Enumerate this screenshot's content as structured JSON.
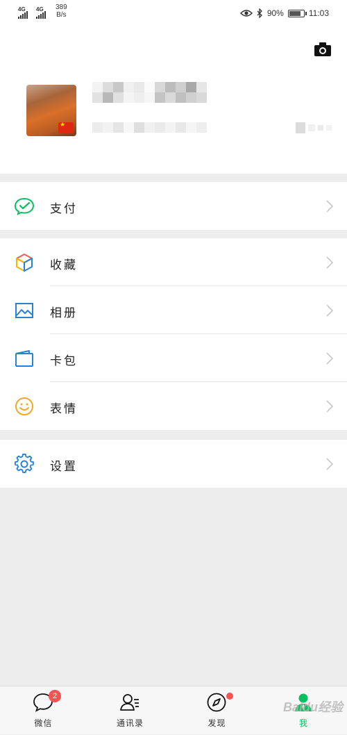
{
  "status_bar": {
    "sim1": "4G",
    "sim2": "4G",
    "net_speed_value": "389",
    "net_speed_unit": "B/s",
    "battery_text": "90%",
    "battery_level": 0.9,
    "time": "11:03"
  },
  "profile": {
    "camera_icon": "camera-icon",
    "avatar": "avatar"
  },
  "menu": {
    "pay": {
      "label": "支付",
      "icon": "wechat-pay-icon",
      "color": "#07c160"
    },
    "favorites": {
      "label": "收藏",
      "icon": "cube-icon"
    },
    "album": {
      "label": "相册",
      "icon": "image-icon",
      "color": "#2782d7"
    },
    "cards": {
      "label": "卡包",
      "icon": "wallet-icon",
      "color": "#2782d7"
    },
    "stickers": {
      "label": "表情",
      "icon": "smiley-icon",
      "color": "#f2a826"
    },
    "settings": {
      "label": "设置",
      "icon": "gear-icon",
      "color": "#2782d7"
    }
  },
  "tabbar": {
    "chats": {
      "label": "微信",
      "badge": "2",
      "icon": "chat-bubble-icon"
    },
    "contacts": {
      "label": "通讯录",
      "icon": "contacts-icon"
    },
    "discover": {
      "label": "发现",
      "icon": "compass-icon"
    },
    "me": {
      "label": "我",
      "icon": "person-icon"
    }
  },
  "watermark": "Baidu经验",
  "colors": {
    "accent": "#07c160",
    "badge": "#fa5151",
    "background": "#ededed"
  }
}
